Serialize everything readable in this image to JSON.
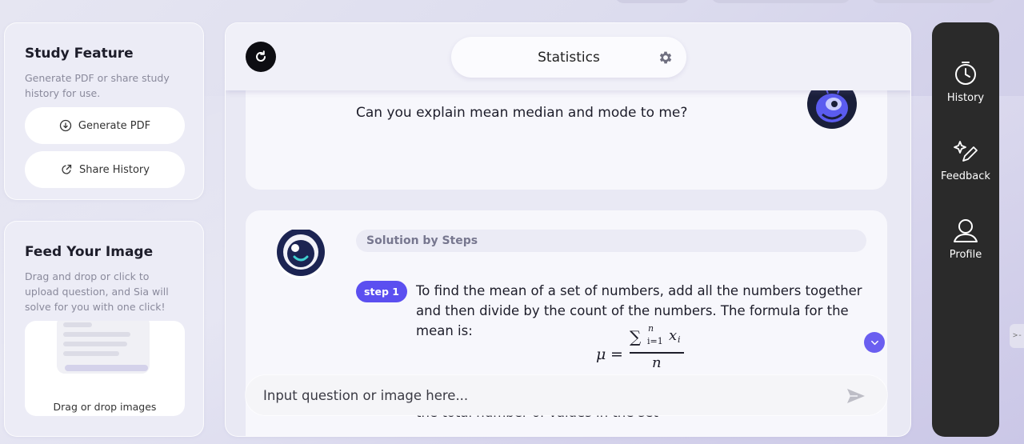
{
  "study_feature": {
    "title": "Study Feature",
    "description": "Generate PDF or share study history for use.",
    "generate_pdf": "Generate PDF",
    "share_history": "Share History"
  },
  "feed_image": {
    "title": "Feed Your Image",
    "description": "Drag and drop or click to upload question, and Sia will solve for you with one click!",
    "drop_label": "Drag or drop images"
  },
  "chat": {
    "subject": "Statistics",
    "user_message": "Can you explain mean median and mode to me?",
    "solution_header": "Solution by Steps",
    "step_badge": "step 1",
    "step_text": "To find the mean of a set of numbers, add all the numbers together and then divide by the count of the numbers. The formula for the mean is:",
    "formula": {
      "mu": "μ",
      "equals": "=",
      "sigma": "∑",
      "upper": "n",
      "lower": "i=1",
      "term": "x",
      "term_sub": "i",
      "denominator": "n"
    },
    "partial_text": "the total number of values in the set"
  },
  "input": {
    "placeholder": "Input question or image here..."
  },
  "rail": {
    "history": "History",
    "feedback": "Feedback",
    "profile": "Profile"
  },
  "edge_tab": ">-"
}
